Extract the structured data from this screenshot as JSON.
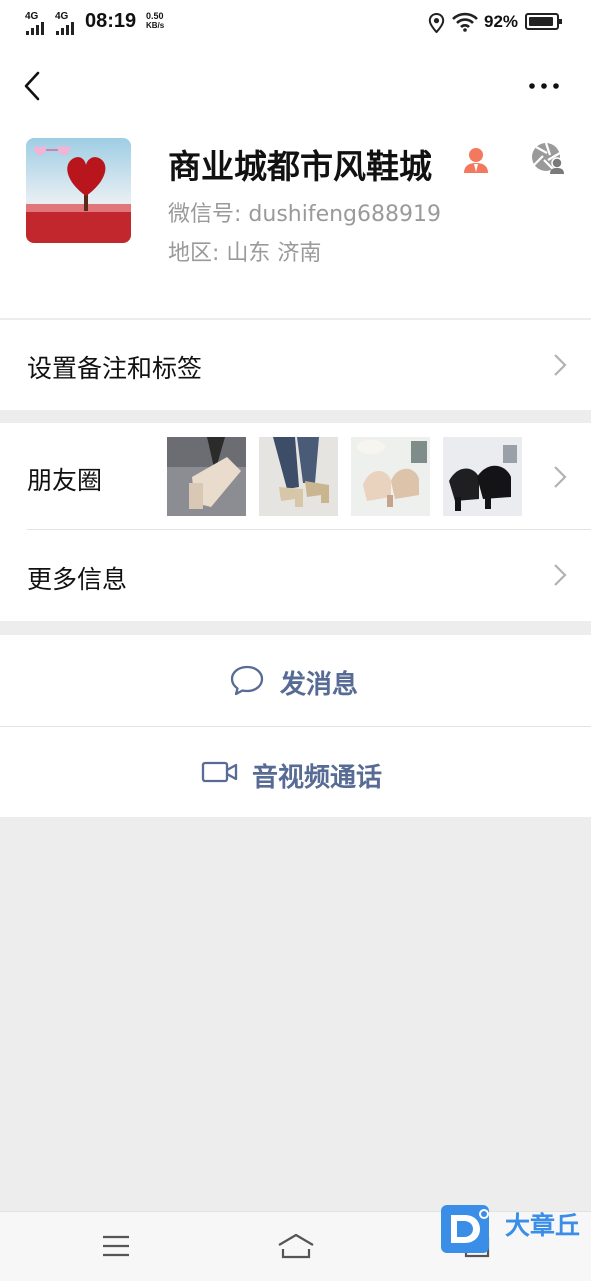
{
  "status_bar": {
    "network_1": "4G",
    "network_2": "4G",
    "time": "08:19",
    "speed_value": "0.50",
    "speed_unit": "KB/s",
    "battery": "92%",
    "battery_level": 0.92
  },
  "profile": {
    "name": "商业城都市风鞋城",
    "wechat_id": "微信号: dushifeng688919",
    "region": "地区: 山东  济南"
  },
  "rows": {
    "remark_tags": "设置备注和标签",
    "moments": "朋友圈",
    "more_info": "更多信息"
  },
  "actions": {
    "send_message": "发消息",
    "video_call": "音视频通话"
  },
  "watermark": {
    "text": "大章丘"
  },
  "colors": {
    "link_blue": "#576b95",
    "owner_icon": "#f2795d",
    "background": "#ededed"
  }
}
